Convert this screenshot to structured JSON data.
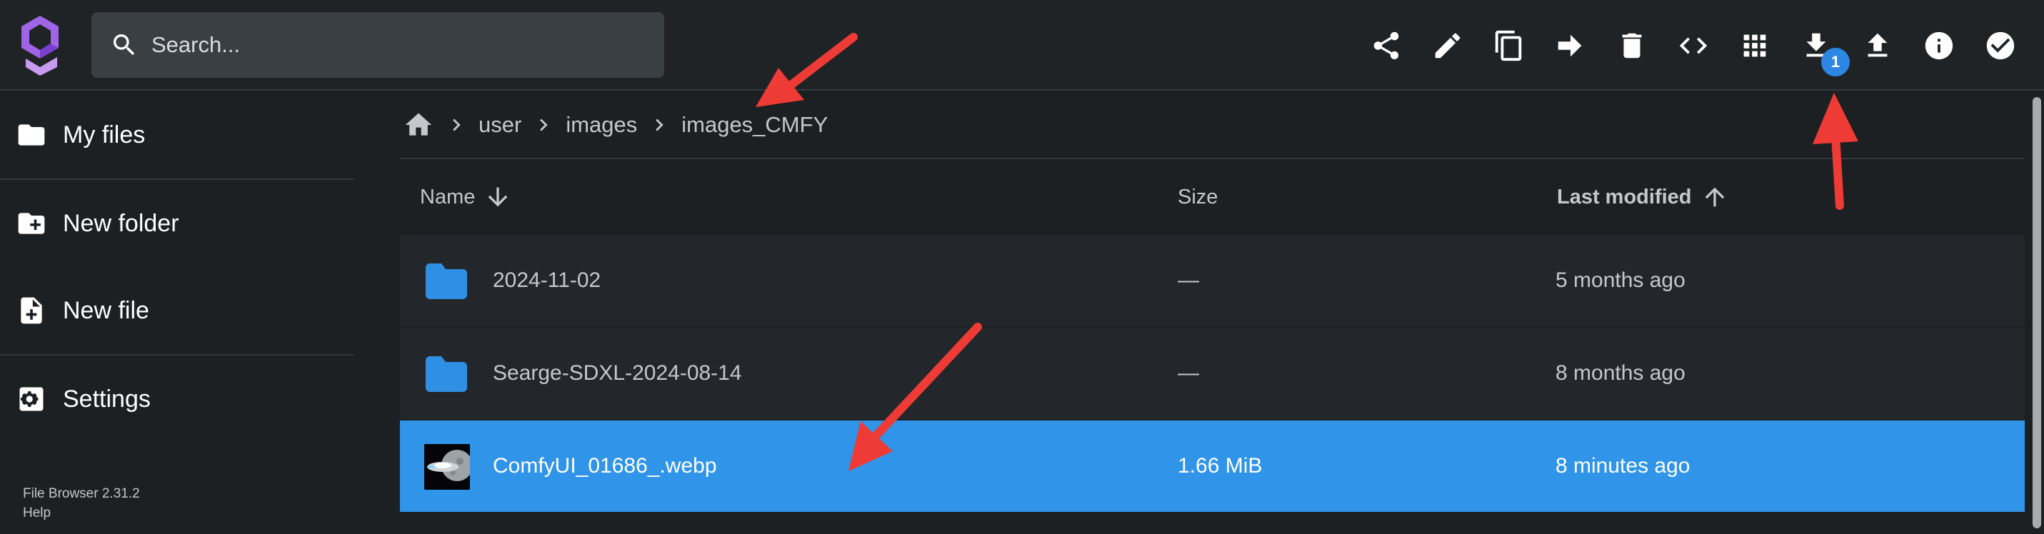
{
  "header": {
    "search_placeholder": "Search...",
    "download_badge": "1",
    "toolbar_icons": [
      "share-icon",
      "edit-icon",
      "copy-icon",
      "move-icon",
      "delete-icon",
      "embed-icon",
      "grid-view-icon",
      "download-icon",
      "upload-icon",
      "info-icon",
      "select-icon"
    ]
  },
  "sidebar": {
    "items": [
      {
        "label": "My files",
        "icon": "folder-icon"
      },
      {
        "label": "New folder",
        "icon": "create-folder-icon"
      },
      {
        "label": "New file",
        "icon": "new-file-icon"
      },
      {
        "label": "Settings",
        "icon": "settings-icon"
      }
    ],
    "footer": {
      "version": "File Browser 2.31.2",
      "help": "Help"
    }
  },
  "breadcrumb": [
    "user",
    "images",
    "images_CMFY"
  ],
  "table": {
    "columns": {
      "name": "Name",
      "size": "Size",
      "modified": "Last modified"
    },
    "rows": [
      {
        "name": "2024-11-02",
        "size": "—",
        "modified": "5 months ago",
        "type": "folder",
        "selected": false
      },
      {
        "name": "Searge-SDXL-2024-08-14",
        "size": "—",
        "modified": "8 months ago",
        "type": "folder",
        "selected": false
      },
      {
        "name": "ComfyUI_01686_.webp",
        "size": "1.66 MiB",
        "modified": "8 minutes ago",
        "type": "image",
        "selected": true
      }
    ]
  },
  "colors": {
    "accent": "#3094e8",
    "folder": "#2f8fe3",
    "annotation": "#ef3b35",
    "logo": "#a064e6"
  }
}
